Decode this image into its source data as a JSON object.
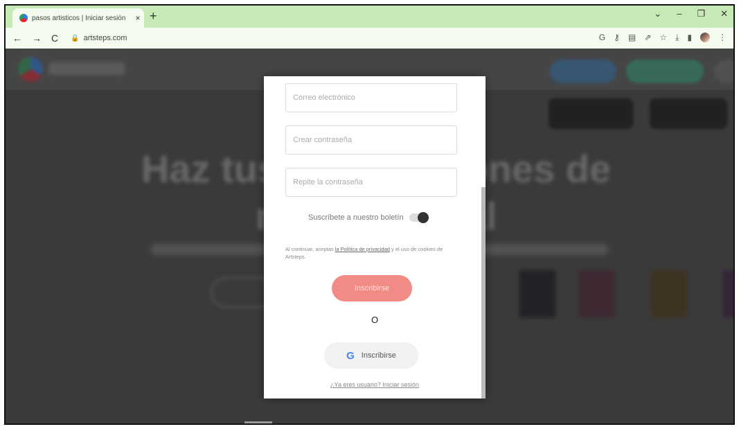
{
  "browser": {
    "tab_title": "pasos artisticos | Iniciar sesión",
    "tab_close": "×",
    "new_tab": "+",
    "url": "artsteps.com",
    "window_controls": [
      "⌄",
      "–",
      "❐",
      "✕"
    ]
  },
  "modal": {
    "email_placeholder": "Correo electrónico",
    "password_placeholder": "Crear contraseña",
    "repeat_placeholder": "Repite la contraseña",
    "newsletter_label": "Suscríbete a nuestro boletín",
    "legal_prefix": "Al continuar, aceptas",
    "legal_link": "la Política de privacidad",
    "legal_suffix": "y el uso de cookies de Artsteps.",
    "submit_label": "Inscribirse",
    "or_label": "O",
    "google_icon_letter": "G",
    "google_label": "Inscribirse",
    "login_link": "¿Ya eres usuario? Iniciar sesión"
  }
}
